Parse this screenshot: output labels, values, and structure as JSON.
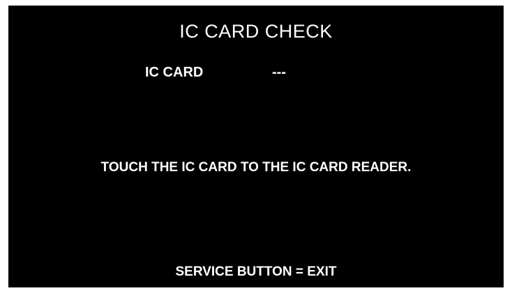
{
  "screen": {
    "title": "IC CARD CHECK",
    "ic_card_label": "IC CARD",
    "ic_card_value": "---",
    "instruction": "TOUCH THE IC CARD TO THE IC CARD READER.",
    "exit_hint": "SERVICE BUTTON = EXIT"
  },
  "colors": {
    "background": "#000000",
    "text": "#ffffff"
  }
}
